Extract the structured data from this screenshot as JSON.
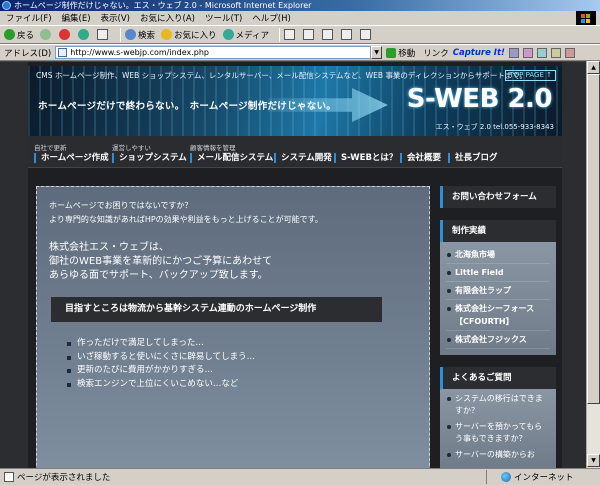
{
  "window": {
    "title": "ホームページ制作だけじゃない。エス・ウェブ 2.0 - Microsoft Internet Explorer"
  },
  "menu": [
    "ファイル(F)",
    "編集(E)",
    "表示(V)",
    "お気に入り(A)",
    "ツール(T)",
    "ヘルプ(H)"
  ],
  "toolbar": {
    "back": "戻る",
    "search": "検索",
    "favorites": "お気に入り",
    "media": "メディア"
  },
  "address": {
    "label": "アドレス(D)",
    "url": "http://www.s-webjp.com/index.php",
    "go": "移動",
    "links": "リンク",
    "capture": "Capture It!"
  },
  "banner": {
    "tagline": "CMS ホームページ制作、WEB ショップシステム、レンタルサーバー、メール配信システムなど、WEB 事業のディレクションからサポートまで。",
    "top_page": "TOP PAGE",
    "catch": "ホームページだけで終わらない。　ホームページ制作だけじゃない。",
    "logo": "S-WEB 2.0",
    "logo_sub": "エス・ウェブ 2.0  tel.055-933-8343"
  },
  "nav": [
    {
      "sub": "自社で更新",
      "label": "ホームページ作成"
    },
    {
      "sub": "運営しやすい",
      "label": "ショップシステム"
    },
    {
      "sub": "顧客情報を管理",
      "label": "メール配信システム"
    },
    {
      "sub": "",
      "label": "システム開発"
    },
    {
      "sub": "",
      "label": "S-WEBとは？"
    },
    {
      "sub": "",
      "label": "会社概要"
    },
    {
      "sub": "",
      "label": "社長ブログ"
    }
  ],
  "main": {
    "intro_line1": "ホームページでお困りではないですか？",
    "intro_line2": "より専門的な知識があればHPの効果や利益をもっと上げることが可能です。",
    "company_line1": "株式会社エス・ウェブは、",
    "company_line2": "御社のWEB事業を革新的にかつご予算にあわせて",
    "company_line3": "あらゆる面でサポート、バックアップ致します。",
    "goal": "目指すところは物流から基幹システム連動のホームページ制作",
    "bullets": [
      "作っただけで満足してしまった…",
      "いざ稼動すると使いにくさに辟易してしまう…",
      "更新のたびに費用がかかりすぎる…",
      "検索エンジンで上位にくいこめない…など"
    ]
  },
  "side": {
    "contact": "お問い合わせフォーム",
    "works_title": "制作実績",
    "works": [
      "北海魚市場",
      "Little Field",
      "有限会社ラップ",
      "株式会社シーフォース【CFOURTH】",
      "株式会社フジックス"
    ],
    "faq_title": "よくあるご質問",
    "faq": [
      "システムの移行はできますか？",
      "サーバーを預かってもらう事もできますか？",
      "サーバーの構築からお"
    ]
  },
  "status": {
    "text": "ページが表示されました",
    "zone": "インターネット"
  }
}
